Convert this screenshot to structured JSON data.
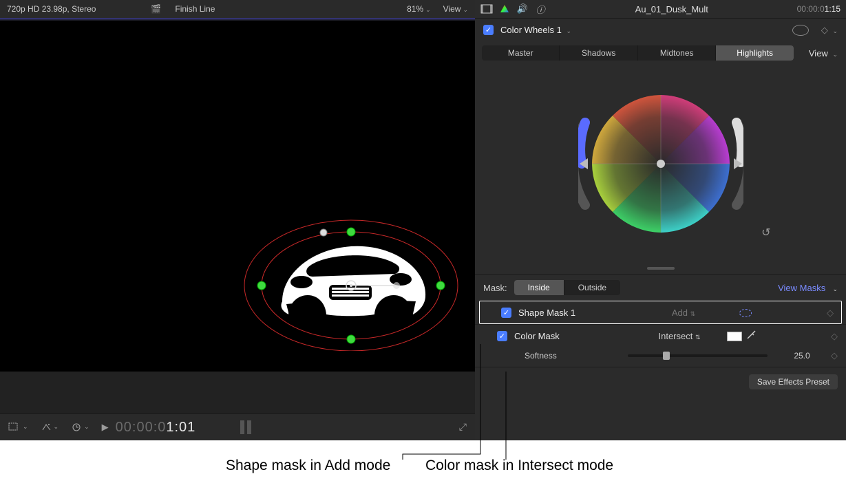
{
  "viewer": {
    "format": "720p HD 23.98p, Stereo",
    "clip_title": "Finish Line",
    "zoom": "81%",
    "view_label": "View",
    "timecode": "00:00:01:01",
    "timecode_prefix": "00:00:0",
    "timecode_suffix": "1:01",
    "clap_icon": "🎬"
  },
  "inspector": {
    "clip_name": "Au_01_Dusk_Mult",
    "timecode": "00:00:01:15",
    "timecode_prefix": "00:00:0",
    "timecode_suffix": "1:15",
    "effect": {
      "enabled": true,
      "name": "Color Wheels 1"
    },
    "tabs": [
      "Master",
      "Shadows",
      "Midtones",
      "Highlights"
    ],
    "active_tab": "Highlights",
    "view_label": "View",
    "mask_label": "Mask:",
    "mask_options": [
      "Inside",
      "Outside"
    ],
    "mask_active": "Inside",
    "view_masks_label": "View Masks",
    "masks": [
      {
        "enabled": true,
        "name": "Shape Mask 1",
        "mode": "Add",
        "kind": "shape"
      },
      {
        "enabled": true,
        "name": "Color Mask",
        "mode": "Intersect",
        "kind": "color"
      }
    ],
    "softness_label": "Softness",
    "softness_value": "25.0",
    "save_label": "Save Effects Preset"
  },
  "annotations": {
    "shape_add": "Shape mask in Add mode",
    "color_intersect": "Color mask in Intersect mode"
  }
}
